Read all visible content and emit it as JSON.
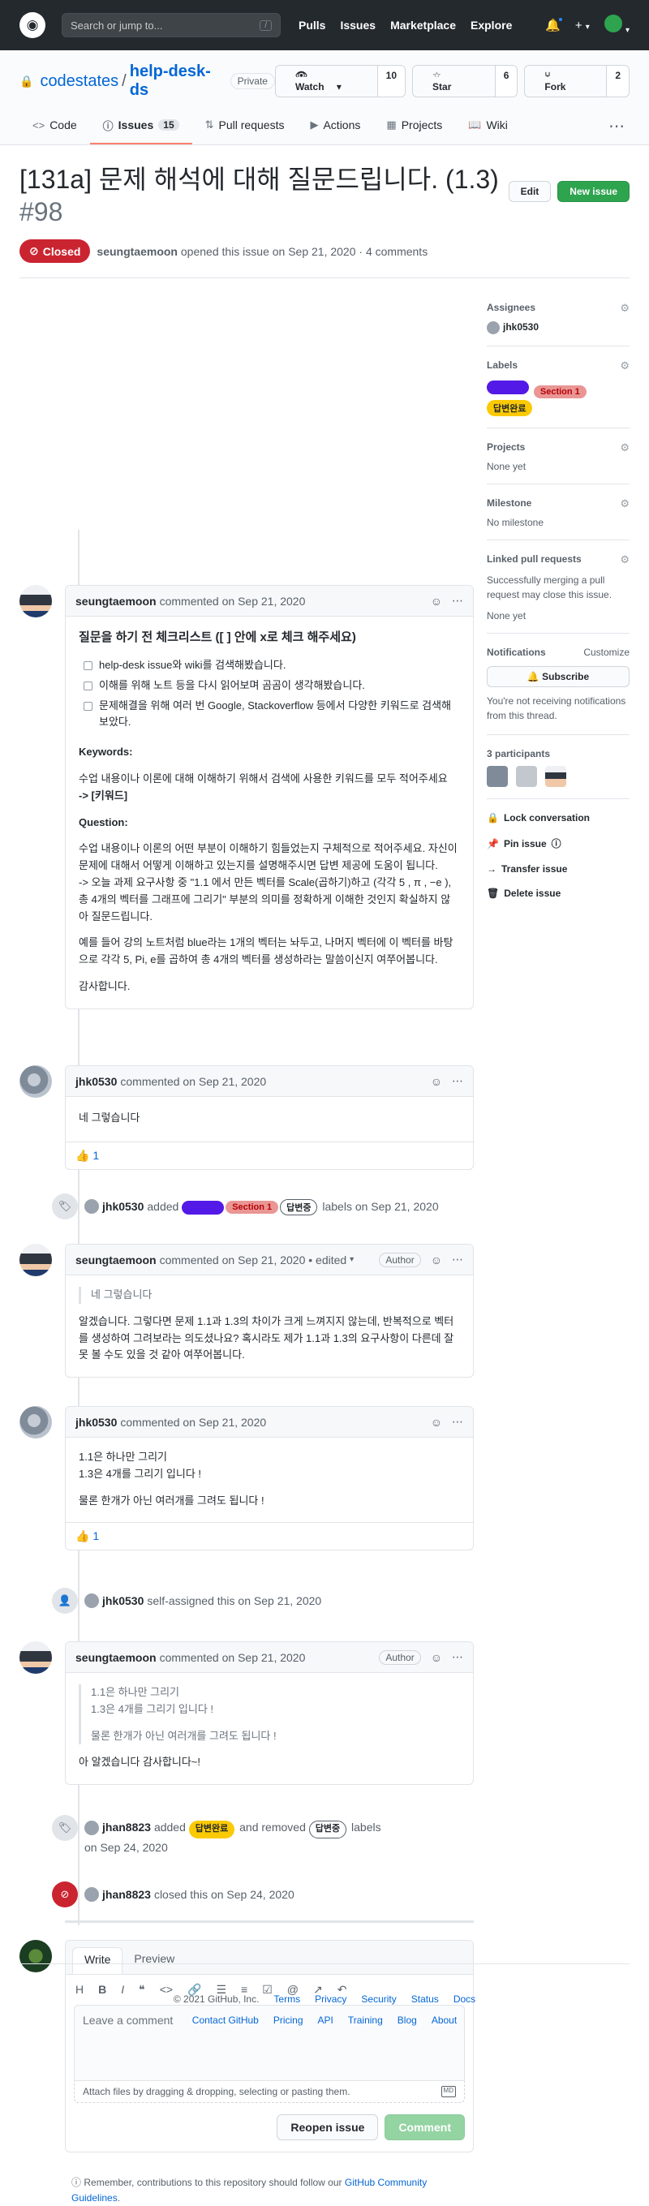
{
  "header": {
    "search_placeholder": "Search or jump to...",
    "slash_key": "/",
    "nav": [
      "Pulls",
      "Issues",
      "Marketplace",
      "Explore"
    ],
    "plus": "+",
    "caret": "▾"
  },
  "repo": {
    "owner": "codestates",
    "separator": "/",
    "name": "help-desk-ds",
    "visibility": "Private",
    "watch_label": "Watch",
    "watch_count": "10",
    "star_label": "Star",
    "star_count": "6",
    "fork_label": "Fork",
    "fork_count": "2"
  },
  "tabs": [
    {
      "label": "Code",
      "icon": "code-icon"
    },
    {
      "label": "Issues",
      "icon": "issue-icon",
      "count": "15"
    },
    {
      "label": "Pull requests",
      "icon": "pull-request-icon"
    },
    {
      "label": "Actions",
      "icon": "play-icon"
    },
    {
      "label": "Projects",
      "icon": "project-icon"
    },
    {
      "label": "Wiki",
      "icon": "book-icon"
    }
  ],
  "issue": {
    "title": "[131a] 문제 해석에 대해 질문드립니다. (1.3)",
    "number": "#98",
    "edit_label": "Edit",
    "new_issue_label": "New issue",
    "state": "Closed",
    "author": "seungtaemoon",
    "meta": "opened this issue on Sep 21, 2020 · 4 comments"
  },
  "comments": [
    {
      "author": "seungtaemoon",
      "meta": "commented on Sep 21, 2020",
      "heading": "질문을 하기 전 체크리스트 ([ ] 안에 x로 체크 해주세요)",
      "checklist": [
        "help-desk issue와 wiki를 검색해봤습니다.",
        "이해를 위해 노트 등을 다시 읽어보며 곰곰이 생각해봤습니다.",
        "문제해결을 위해 여러 번 Google, Stackoverflow 등에서 다양한 키워드로 검색해 보았다."
      ],
      "keywords_heading": "Keywords:",
      "keywords_text": "수업 내용이나 이론에 대해 이해하기 위해서 검색에 사용한 키워드를 모두 적어주세요",
      "keywords_value": "-> [키워드]",
      "question_heading": "Question:",
      "question_p1": "수업 내용이나 이론의 어떤 부분이 이해하기 힘들었는지 구체적으로 적어주세요. 자신이 문제에 대해서 어떻게 이해하고 있는지를 설명해주시면 답변 제공에 도움이 됩니다.",
      "question_p2": "-> 오늘 과제 요구사항 중 \"1.1 에서 만든 벡터를 Scale(곱하기)하고 (각각 5 , π , −e ), 총 4개의 벡터를 그래프에 그리기\" 부분의 의미를 정확하게 이해한 것인지 확실하지 않아 질문드립니다.",
      "question_p3": "예를 들어 강의 노트처럼 blue라는 1개의 벡터는 놔두고, 나머지 벡터에 이 벡터를 바탕으로 각각 5, Pi, e를 곱하여 총 4개의 벡터를 생성하라는 말씀이신지 여쭈어봅니다.",
      "thanks": "감사합니다."
    },
    {
      "author": "jhk0530",
      "meta": "commented on Sep 21, 2020",
      "body": "네 그렇습니다",
      "reaction": "👍",
      "reaction_count": "1"
    },
    {
      "author": "seungtaemoon",
      "meta": "commented on Sep 21, 2020 • edited",
      "badge": "Author",
      "quote": "네 그렇습니다",
      "body": "알겠습니다. 그렇다면 문제 1.1과 1.3의 차이가 크게 느껴지지 않는데, 반복적으로 벡터를 생성하여 그려보라는 의도셨나요? 혹시라도 제가 1.1과 1.3의 요구사항이 다른데 잘 못 볼 수도 있을 것 같아 여쭈어봅니다."
    },
    {
      "author": "jhk0530",
      "meta": "commented on Sep 21, 2020",
      "line1": "1.1은 하나만 그리기",
      "line2": "1.3은 4개를 그리기 입니다 !",
      "line3": "물론 한개가 아닌 여러개를 그려도 됩니다 !",
      "reaction": "👍",
      "reaction_count": "1"
    },
    {
      "author": "seungtaemoon",
      "meta": "commented on Sep 21, 2020",
      "badge": "Author",
      "quote1": "1.1은 하나만 그리기",
      "quote2": "1.3은 4개를 그리기 입니다 !",
      "quote3": "물론 한개가 아닌 여러개를 그려도 됩니다 !",
      "body": "아 알겠습니다 감사합니다~!"
    }
  ],
  "events": {
    "labels_added": {
      "actor": "jhk0530",
      "verb": "added",
      "labels_suffix": "labels on Sep 21, 2020"
    },
    "self_assigned": {
      "actor": "jhk0530",
      "text": "self-assigned this on Sep 21, 2020"
    },
    "labels_changed": {
      "actor": "jhan8823",
      "verb": "added",
      "mid": "and removed",
      "suffix": "labels",
      "date": "on Sep 24, 2020"
    },
    "closed": {
      "actor": "jhan8823",
      "text": "closed this on Sep 24, 2020"
    }
  },
  "labels": {
    "l1": {
      "name": "",
      "bg": "#5319e7",
      "fg": "#ffffff"
    },
    "l2": {
      "name": "Section 1",
      "bg": "#e99695",
      "fg": "#b60205"
    },
    "l3": {
      "name": "답변완료",
      "bg": "#fbca04",
      "fg": "#24292e"
    },
    "l4": {
      "name": "답변중",
      "bg": "#ffffff",
      "fg": "#24292e"
    }
  },
  "sidebar": {
    "assignees_title": "Assignees",
    "assignee": "jhk0530",
    "labels_title": "Labels",
    "projects_title": "Projects",
    "projects_value": "None yet",
    "milestone_title": "Milestone",
    "milestone_value": "No milestone",
    "linked_title": "Linked pull requests",
    "linked_text": "Successfully merging a pull request may close this issue.",
    "linked_value": "None yet",
    "notifications_title": "Notifications",
    "customize": "Customize",
    "subscribe": "Subscribe",
    "notif_text": "You're not receiving notifications from this thread.",
    "participants_title": "3 participants",
    "lock": "Lock conversation",
    "pin": "Pin issue",
    "transfer": "Transfer issue",
    "delete": "Delete issue"
  },
  "composer": {
    "tab_write": "Write",
    "tab_preview": "Preview",
    "placeholder": "Leave a comment",
    "attach": "Attach files by dragging & dropping, selecting or pasting them.",
    "md": "MD",
    "reopen": "Reopen issue",
    "comment": "Comment",
    "note_prefix": "Remember, contributions to this repository should follow our",
    "note_link": "GitHub Community Guidelines",
    "note_suffix": "."
  },
  "footer": {
    "copyright": "© 2021 GitHub, Inc.",
    "row1": [
      "Terms",
      "Privacy",
      "Security",
      "Status",
      "Docs"
    ],
    "row2": [
      "Contact GitHub",
      "Pricing",
      "API",
      "Training",
      "Blog",
      "About"
    ]
  }
}
